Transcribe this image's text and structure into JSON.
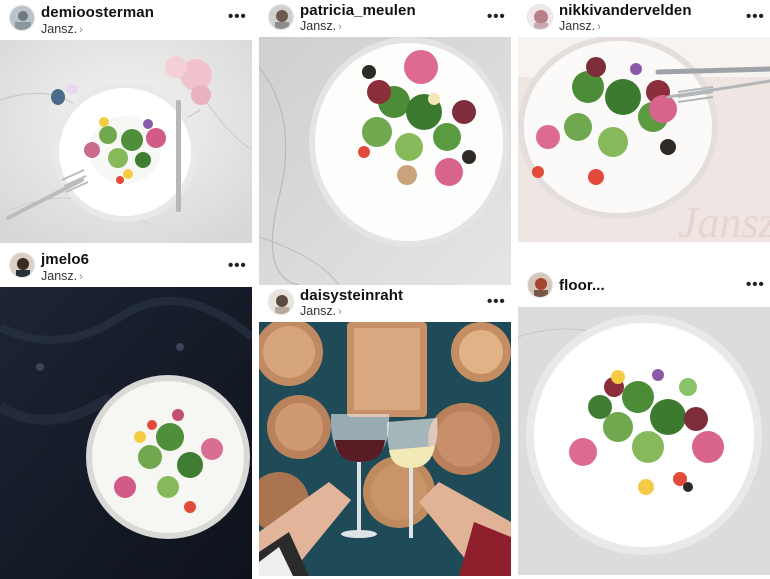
{
  "posts": [
    {
      "username": "demioosterman",
      "location": "Jansz.",
      "more": "•••"
    },
    {
      "username": "jmelo6",
      "location": "Jansz.",
      "more": "•••"
    },
    {
      "username": "patricia_meulen",
      "location": "Jansz.",
      "more": "•••"
    },
    {
      "username": "daisysteinraht",
      "location": "Jansz.",
      "more": "•••"
    },
    {
      "username": "nikkivandervelden",
      "location": "Jansz.",
      "more": "•••"
    },
    {
      "username": "floor...",
      "location": "",
      "more": "•••"
    }
  ],
  "watermark": "Jansz.",
  "icons": {
    "chevron": "›",
    "more": "more-options-icon"
  }
}
